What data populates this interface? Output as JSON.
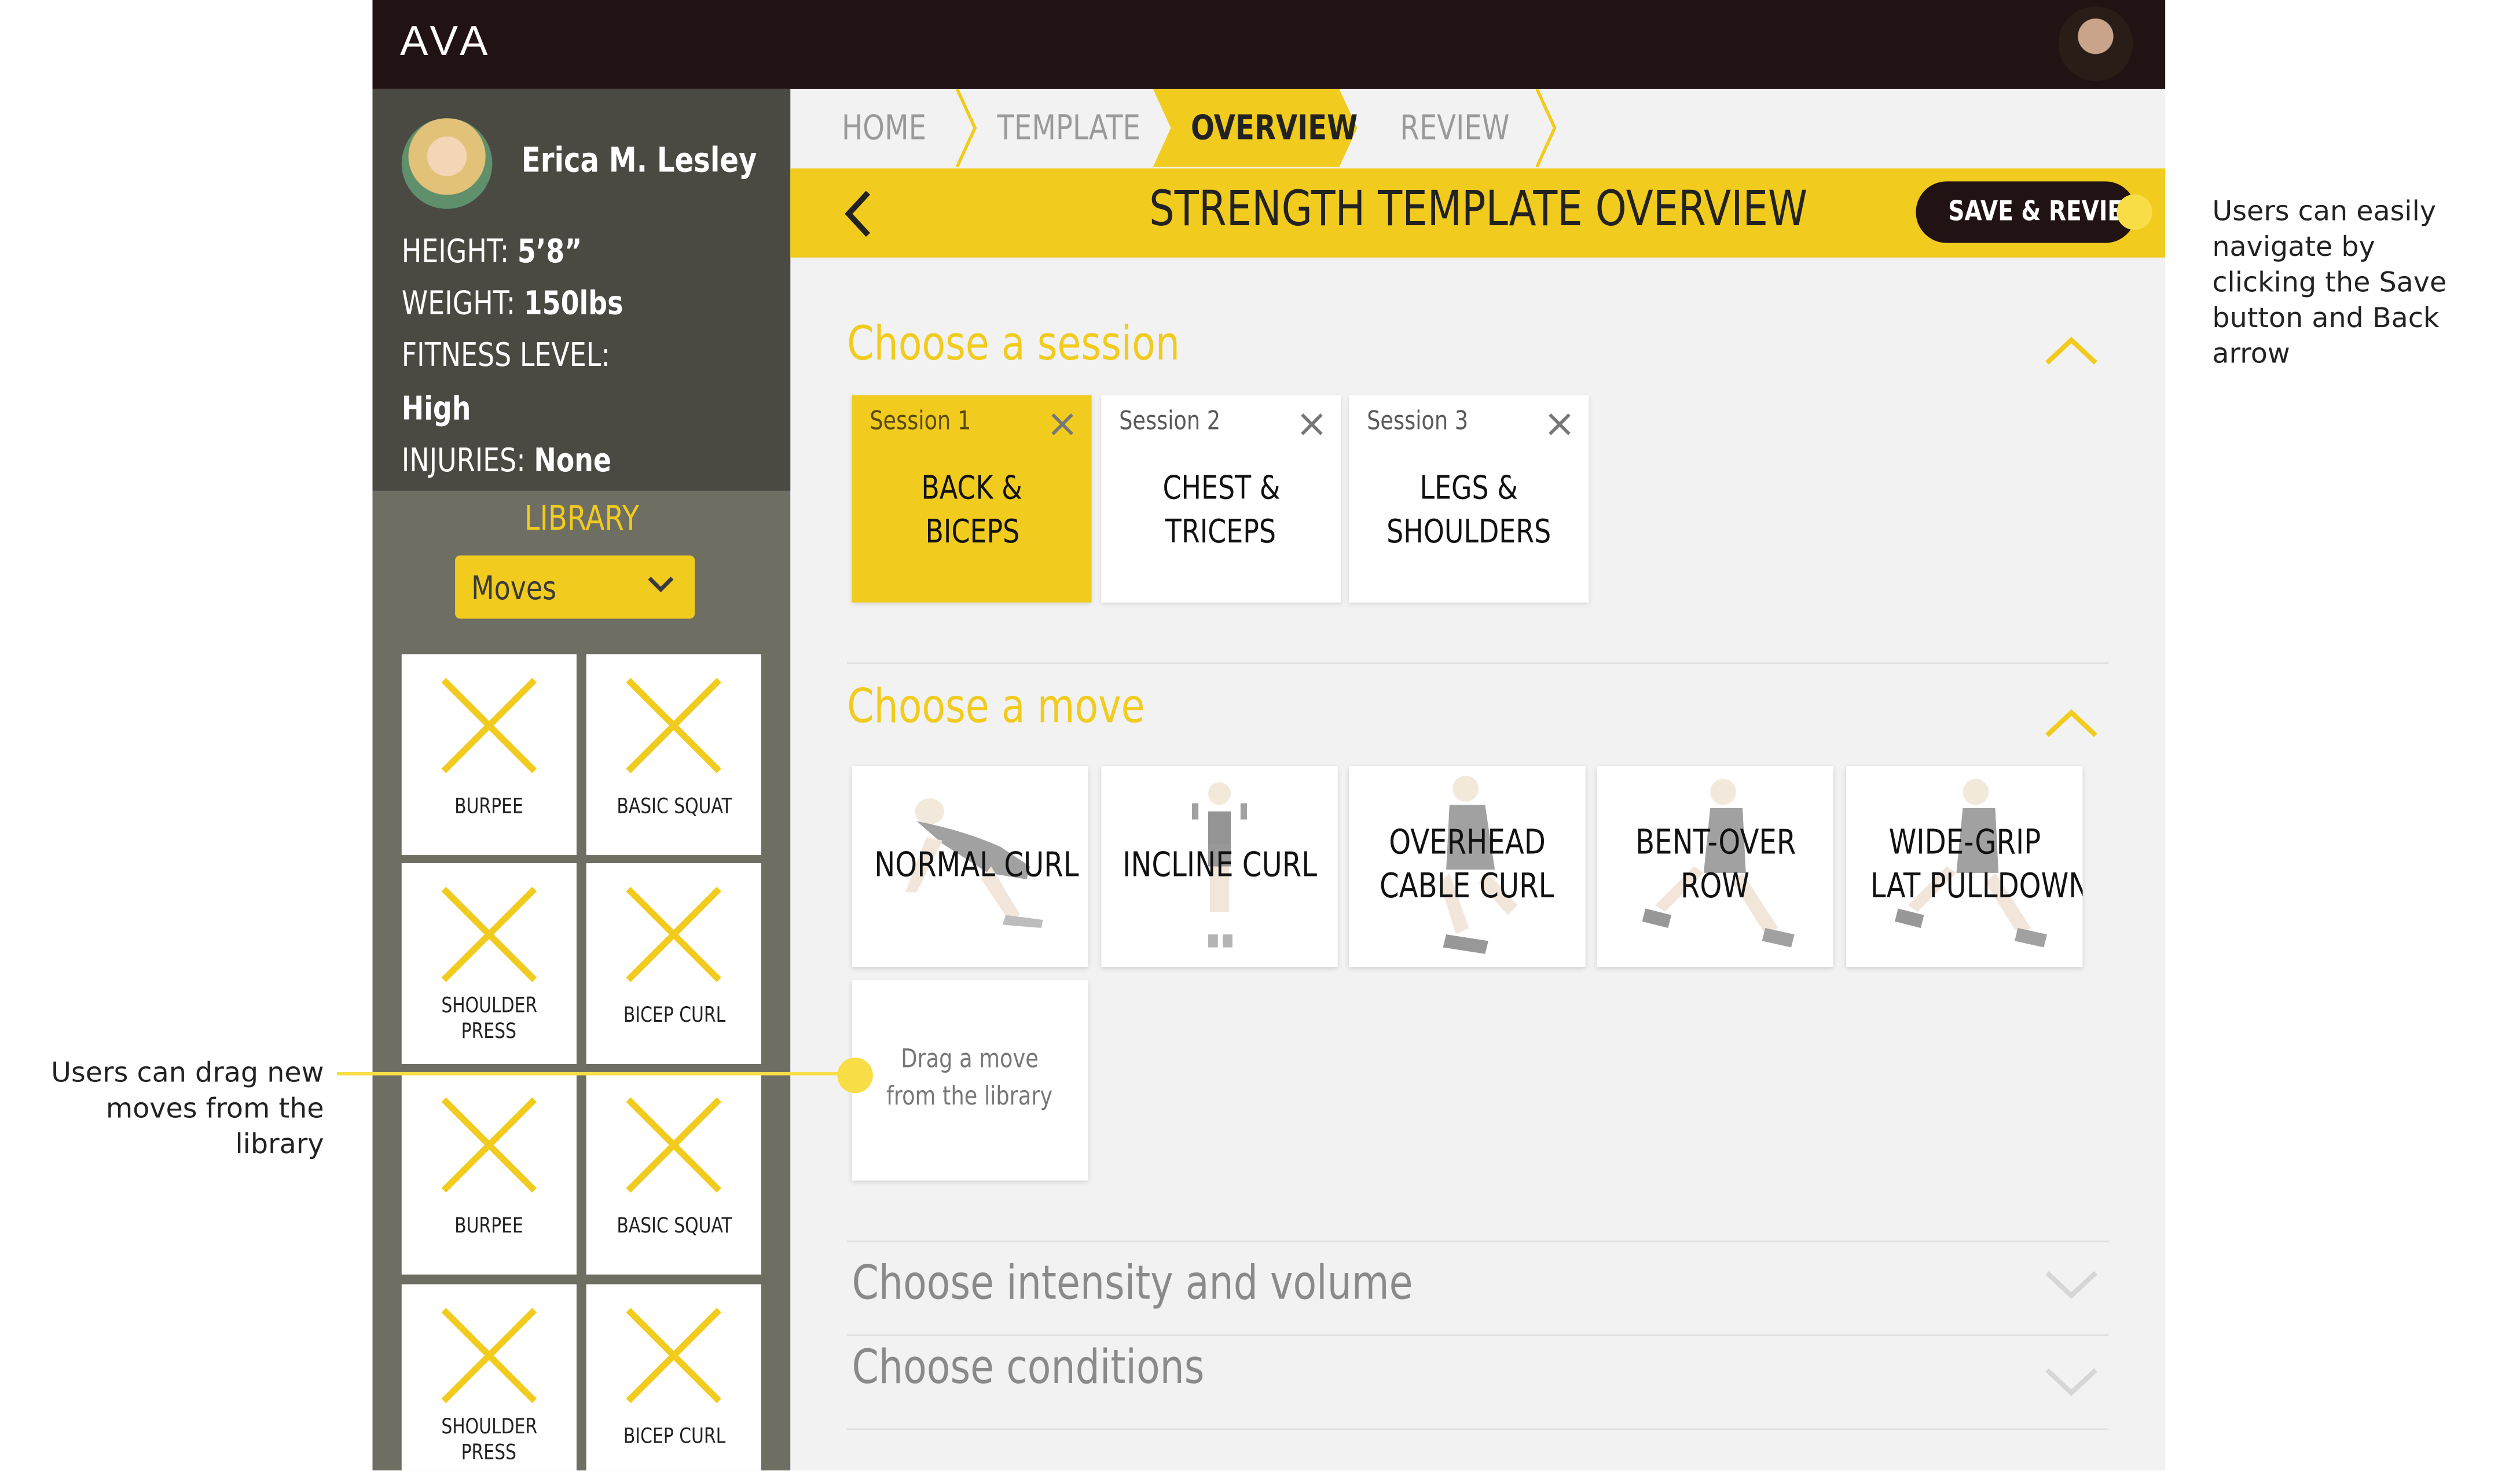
{
  "app": {
    "logo": "AVA"
  },
  "profile": {
    "name": "Erica M. Lesley",
    "height_label": "HEIGHT:",
    "height_value": "5’8”",
    "weight_label": "WEIGHT:",
    "weight_value": "150lbs",
    "fitness_label": "FITNESS LEVEL:",
    "fitness_value": "High",
    "injuries_label": "INJURIES:",
    "injuries_value": "None"
  },
  "library": {
    "label": "LIBRARY",
    "dropdown_value": "Moves",
    "tiles": [
      {
        "line1": "BURPEE",
        "line2": ""
      },
      {
        "line1": "BASIC SQUAT",
        "line2": ""
      },
      {
        "line1": "SHOULDER",
        "line2": "PRESS"
      },
      {
        "line1": "BICEP CURL",
        "line2": ""
      },
      {
        "line1": "BURPEE",
        "line2": ""
      },
      {
        "line1": "BASIC SQUAT",
        "line2": ""
      },
      {
        "line1": "SHOULDER",
        "line2": "PRESS"
      },
      {
        "line1": "BICEP CURL",
        "line2": ""
      }
    ]
  },
  "breadcrumb": [
    "HOME",
    "TEMPLATE",
    "OVERVIEW",
    "REVIEW"
  ],
  "header": {
    "title": "STRENGTH TEMPLATE OVERVIEW",
    "save_label": "SAVE & REVIEW"
  },
  "sections": {
    "session_title": "Choose a session",
    "move_title": "Choose a move",
    "intensity_title": "Choose intensity and volume",
    "conditions_title": "Choose conditions"
  },
  "sessions": [
    {
      "num": "Session 1",
      "line1": "BACK &",
      "line2": "BICEPS",
      "selected": true
    },
    {
      "num": "Session 2",
      "line1": "CHEST &",
      "line2": "TRICEPS",
      "selected": false
    },
    {
      "num": "Session 3",
      "line1": "LEGS &",
      "line2": "SHOULDERS",
      "selected": false
    }
  ],
  "moves": [
    {
      "line1": "NORMAL CURL",
      "line2": ""
    },
    {
      "line1": "INCLINE CURL",
      "line2": ""
    },
    {
      "line1": "OVERHEAD",
      "line2": "CABLE CURL"
    },
    {
      "line1": "BENT-OVER",
      "line2": "ROW"
    },
    {
      "line1": "WIDE-GRIP",
      "line2": "LAT PULLDOWN"
    }
  ],
  "dropzone": {
    "line1": "Drag a move",
    "line2": "from the library"
  },
  "annotations": {
    "right_note": [
      "Users can easily",
      "navigate by",
      "clicking the Save",
      "button and Back",
      "arrow"
    ],
    "left_note": [
      "Users can drag new",
      "moves from the",
      "library"
    ]
  },
  "colors": {
    "accent": "#f1cb1d",
    "topbar": "#211213",
    "sidebar": "#6e6e63",
    "profile_bg": "#4a4a43",
    "hotspot": "#f9dd46"
  }
}
